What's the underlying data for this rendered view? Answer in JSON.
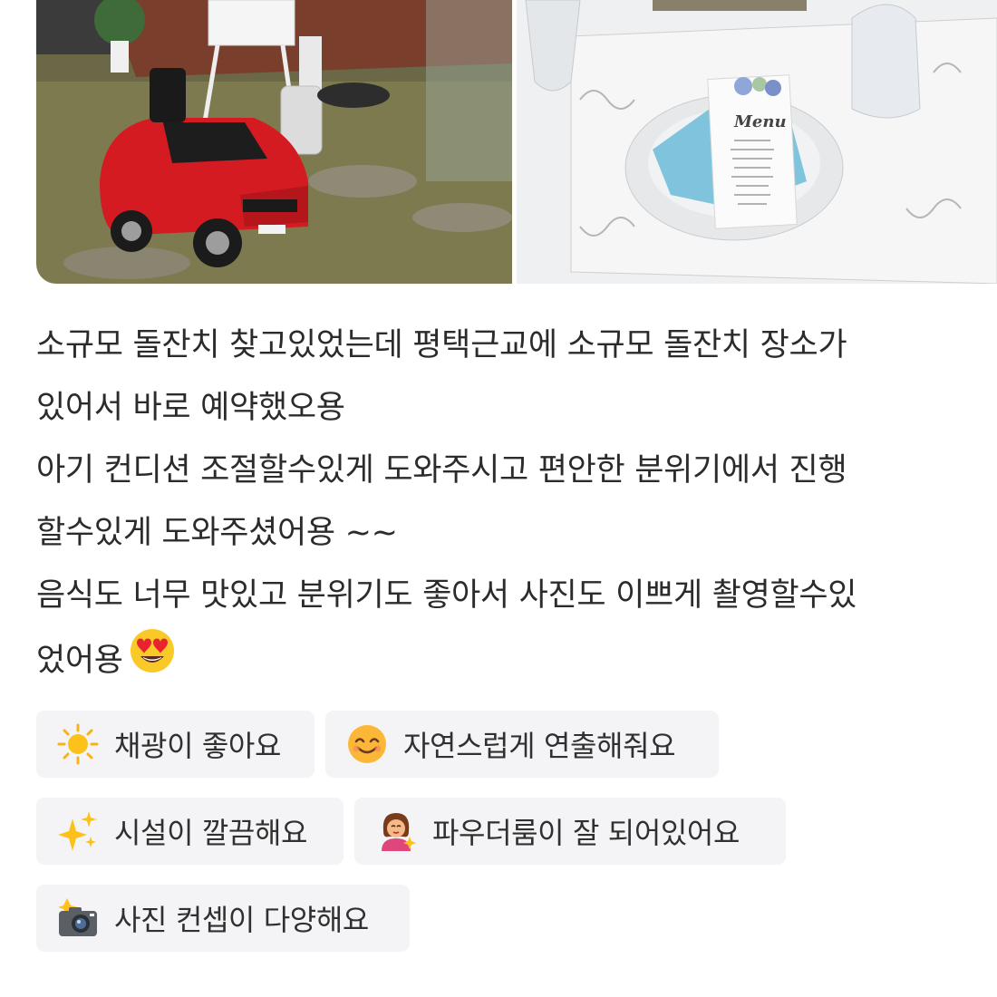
{
  "photos": [
    {
      "alt": "red toy car on lawn with easel and lanterns"
    },
    {
      "alt": "table setting with plate, blue napkin and printed menu card",
      "menu_title": "Menu"
    }
  ],
  "review": {
    "lines": [
      "소규모 돌잔치 찾고있었는데 평택근교에 소규모 돌잔치 장소가",
      "있어서 바로 예약했오용",
      "아기 컨디션 조절할수있게 도와주시고 편안한 분위기에서 진행",
      "할수있게 도와주셨어용 ~~",
      "음식도 너무 맛있고 분위기도 좋아서 사진도 이쁘게 촬영할수있",
      "었어용"
    ],
    "end_emoji": "smiling-face-with-heart-eyes"
  },
  "keywords": [
    {
      "icon": "sun-icon",
      "label": "채광이 좋아요"
    },
    {
      "icon": "smiling-face-icon",
      "label": "자연스럽게 연출해줘요"
    },
    {
      "icon": "sparkles-icon",
      "label": "시설이 깔끔해요"
    },
    {
      "icon": "person-getting-makeup-icon",
      "label": "파우더룸이 잘 되어있어요"
    },
    {
      "icon": "camera-with-flash-icon",
      "label": "사진 컨셉이 다양해요"
    }
  ],
  "colors": {
    "text": "#2b2b2b",
    "chip_bg": "#f4f4f6"
  }
}
